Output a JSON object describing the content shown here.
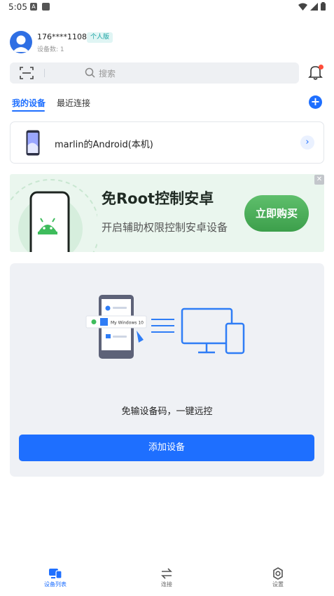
{
  "status_bar": {
    "time": "5:05",
    "notification_letter": "A"
  },
  "profile": {
    "phone": "176****1108",
    "edition": "个人版",
    "device_count": "设备数: 1"
  },
  "search": {
    "placeholder": "搜索"
  },
  "tabs": [
    {
      "label": "我的设备",
      "active": true
    },
    {
      "label": "最近连接",
      "active": false
    }
  ],
  "devices": [
    {
      "name": "marlin的Android(本机)"
    }
  ],
  "banner": {
    "title": "免Root控制安卓",
    "subtitle": "开启辅助权限控制安卓设备",
    "button": "立即购买",
    "close": "✕"
  },
  "promo": {
    "illustration_label": "My Windows 10",
    "text": "免输设备码，一键远控",
    "button": "添加设备"
  },
  "bottom_nav": [
    {
      "label": "设备列表",
      "icon": "device-list-icon",
      "active": true
    },
    {
      "label": "连接",
      "icon": "connect-icon",
      "active": false
    },
    {
      "label": "设置",
      "icon": "gear-icon",
      "active": false
    }
  ],
  "colors": {
    "accent": "#1e6fff",
    "banner_green": "#4cae5a",
    "notification_dot": "#ff4d3a"
  }
}
